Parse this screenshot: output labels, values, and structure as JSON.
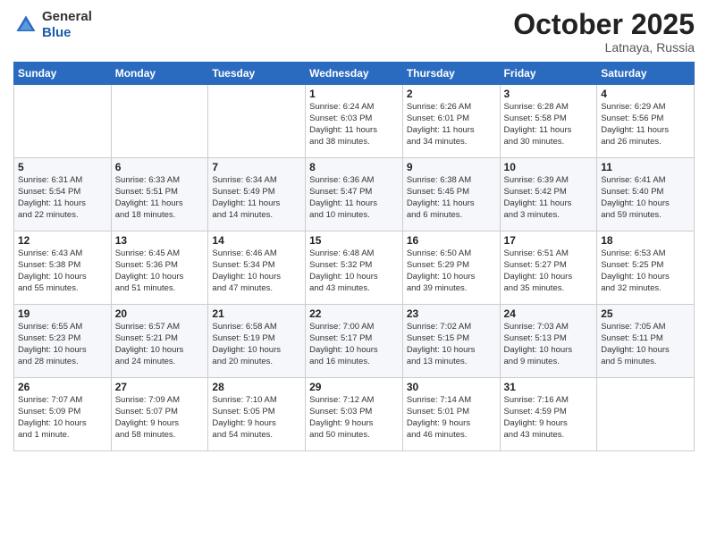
{
  "header": {
    "logo_general": "General",
    "logo_blue": "Blue",
    "month": "October 2025",
    "location": "Latnaya, Russia"
  },
  "weekdays": [
    "Sunday",
    "Monday",
    "Tuesday",
    "Wednesday",
    "Thursday",
    "Friday",
    "Saturday"
  ],
  "weeks": [
    [
      {
        "day": "",
        "info": ""
      },
      {
        "day": "",
        "info": ""
      },
      {
        "day": "",
        "info": ""
      },
      {
        "day": "1",
        "info": "Sunrise: 6:24 AM\nSunset: 6:03 PM\nDaylight: 11 hours\nand 38 minutes."
      },
      {
        "day": "2",
        "info": "Sunrise: 6:26 AM\nSunset: 6:01 PM\nDaylight: 11 hours\nand 34 minutes."
      },
      {
        "day": "3",
        "info": "Sunrise: 6:28 AM\nSunset: 5:58 PM\nDaylight: 11 hours\nand 30 minutes."
      },
      {
        "day": "4",
        "info": "Sunrise: 6:29 AM\nSunset: 5:56 PM\nDaylight: 11 hours\nand 26 minutes."
      }
    ],
    [
      {
        "day": "5",
        "info": "Sunrise: 6:31 AM\nSunset: 5:54 PM\nDaylight: 11 hours\nand 22 minutes."
      },
      {
        "day": "6",
        "info": "Sunrise: 6:33 AM\nSunset: 5:51 PM\nDaylight: 11 hours\nand 18 minutes."
      },
      {
        "day": "7",
        "info": "Sunrise: 6:34 AM\nSunset: 5:49 PM\nDaylight: 11 hours\nand 14 minutes."
      },
      {
        "day": "8",
        "info": "Sunrise: 6:36 AM\nSunset: 5:47 PM\nDaylight: 11 hours\nand 10 minutes."
      },
      {
        "day": "9",
        "info": "Sunrise: 6:38 AM\nSunset: 5:45 PM\nDaylight: 11 hours\nand 6 minutes."
      },
      {
        "day": "10",
        "info": "Sunrise: 6:39 AM\nSunset: 5:42 PM\nDaylight: 11 hours\nand 3 minutes."
      },
      {
        "day": "11",
        "info": "Sunrise: 6:41 AM\nSunset: 5:40 PM\nDaylight: 10 hours\nand 59 minutes."
      }
    ],
    [
      {
        "day": "12",
        "info": "Sunrise: 6:43 AM\nSunset: 5:38 PM\nDaylight: 10 hours\nand 55 minutes."
      },
      {
        "day": "13",
        "info": "Sunrise: 6:45 AM\nSunset: 5:36 PM\nDaylight: 10 hours\nand 51 minutes."
      },
      {
        "day": "14",
        "info": "Sunrise: 6:46 AM\nSunset: 5:34 PM\nDaylight: 10 hours\nand 47 minutes."
      },
      {
        "day": "15",
        "info": "Sunrise: 6:48 AM\nSunset: 5:32 PM\nDaylight: 10 hours\nand 43 minutes."
      },
      {
        "day": "16",
        "info": "Sunrise: 6:50 AM\nSunset: 5:29 PM\nDaylight: 10 hours\nand 39 minutes."
      },
      {
        "day": "17",
        "info": "Sunrise: 6:51 AM\nSunset: 5:27 PM\nDaylight: 10 hours\nand 35 minutes."
      },
      {
        "day": "18",
        "info": "Sunrise: 6:53 AM\nSunset: 5:25 PM\nDaylight: 10 hours\nand 32 minutes."
      }
    ],
    [
      {
        "day": "19",
        "info": "Sunrise: 6:55 AM\nSunset: 5:23 PM\nDaylight: 10 hours\nand 28 minutes."
      },
      {
        "day": "20",
        "info": "Sunrise: 6:57 AM\nSunset: 5:21 PM\nDaylight: 10 hours\nand 24 minutes."
      },
      {
        "day": "21",
        "info": "Sunrise: 6:58 AM\nSunset: 5:19 PM\nDaylight: 10 hours\nand 20 minutes."
      },
      {
        "day": "22",
        "info": "Sunrise: 7:00 AM\nSunset: 5:17 PM\nDaylight: 10 hours\nand 16 minutes."
      },
      {
        "day": "23",
        "info": "Sunrise: 7:02 AM\nSunset: 5:15 PM\nDaylight: 10 hours\nand 13 minutes."
      },
      {
        "day": "24",
        "info": "Sunrise: 7:03 AM\nSunset: 5:13 PM\nDaylight: 10 hours\nand 9 minutes."
      },
      {
        "day": "25",
        "info": "Sunrise: 7:05 AM\nSunset: 5:11 PM\nDaylight: 10 hours\nand 5 minutes."
      }
    ],
    [
      {
        "day": "26",
        "info": "Sunrise: 7:07 AM\nSunset: 5:09 PM\nDaylight: 10 hours\nand 1 minute."
      },
      {
        "day": "27",
        "info": "Sunrise: 7:09 AM\nSunset: 5:07 PM\nDaylight: 9 hours\nand 58 minutes."
      },
      {
        "day": "28",
        "info": "Sunrise: 7:10 AM\nSunset: 5:05 PM\nDaylight: 9 hours\nand 54 minutes."
      },
      {
        "day": "29",
        "info": "Sunrise: 7:12 AM\nSunset: 5:03 PM\nDaylight: 9 hours\nand 50 minutes."
      },
      {
        "day": "30",
        "info": "Sunrise: 7:14 AM\nSunset: 5:01 PM\nDaylight: 9 hours\nand 46 minutes."
      },
      {
        "day": "31",
        "info": "Sunrise: 7:16 AM\nSunset: 4:59 PM\nDaylight: 9 hours\nand 43 minutes."
      },
      {
        "day": "",
        "info": ""
      }
    ]
  ]
}
